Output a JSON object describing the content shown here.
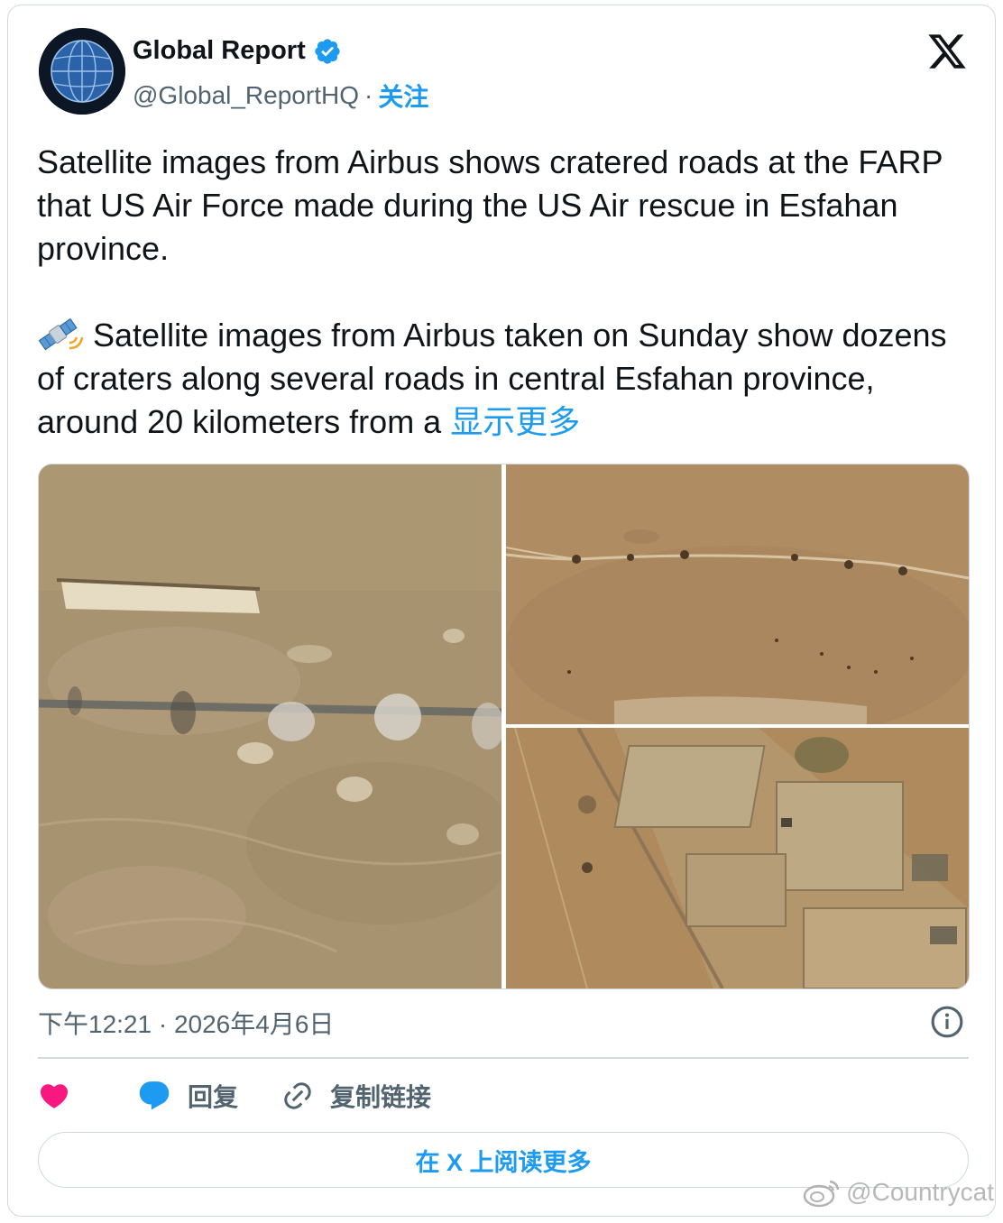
{
  "author": {
    "name": "Global Report",
    "handle": "@Global_ReportHQ",
    "separator": "·",
    "follow_label": "关注",
    "verified": true
  },
  "icons": {
    "avatar": "globe-icon",
    "verified": "verified-badge-icon",
    "brand": "x-logo-icon",
    "emoji": "satellite-icon",
    "info": "info-icon",
    "like": "heart-icon",
    "reply": "reply-bubble-icon",
    "copy_link": "link-icon",
    "watermark": "weibo-icon"
  },
  "tweet": {
    "paragraph1": "Satellite images from Airbus shows cratered roads at the FARP that US Air Force made during the US Air rescue in Esfahan province.",
    "paragraph2": "Satellite images from Airbus taken on Sunday show dozens of craters along several roads in central Esfahan province, around 20 kilometers from a",
    "show_more": "显示更多"
  },
  "meta": {
    "time": "下午12:21",
    "separator": "·",
    "date": "2026年4月6日"
  },
  "actions": {
    "reply_label": "回复",
    "copy_link_label": "复制链接"
  },
  "read_more_label": "在 X 上阅读更多",
  "watermark": "@Countrycat",
  "colors": {
    "accent": "#1d9bf0",
    "like": "#f91880",
    "text": "#0f1419",
    "muted": "#536471",
    "border": "#cfd9de"
  }
}
